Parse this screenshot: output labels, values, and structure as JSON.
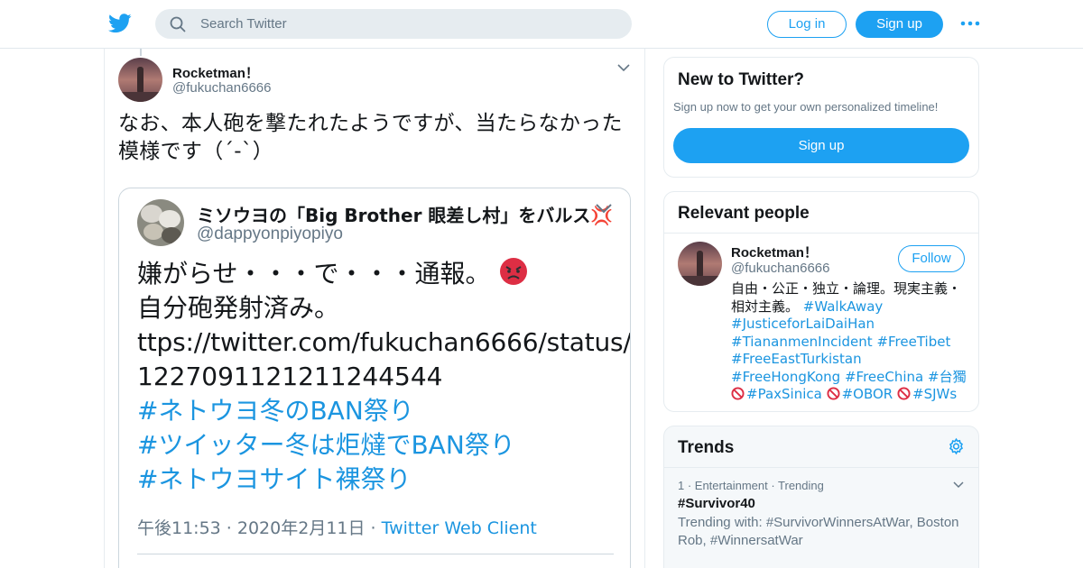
{
  "header": {
    "search_placeholder": "Search Twitter",
    "login_label": "Log in",
    "signup_label": "Sign up",
    "accent": "#1da1f2"
  },
  "tweet": {
    "name": "Rocketman！",
    "handle": "@fukuchan6666",
    "text": "なお、本人砲を撃たれたようですが、当たらなかった模様です（´-`）"
  },
  "quoted": {
    "name": "ミソウヨの「Big Brother 眼差し村」をバルス💢",
    "handle": "@dappyonpiyopiyo",
    "line1": "嫌がらせ・・・で・・・通報。",
    "line2": "自分砲発射済み。",
    "line3": "ttps://twitter.com/fukuchan6666/status/",
    "line4": "1227091121211244544",
    "hashtags": [
      "#ネトウヨ冬のBAN祭り",
      "#ツイッター冬は炬燵でBAN祭り",
      "#ネトウヨサイト裸祭り"
    ],
    "timestamp": "午後11:53 · 2020年2月11日 · ",
    "client": "Twitter Web Client"
  },
  "new_to_twitter": {
    "title": "New to Twitter?",
    "subtitle": "Sign up now to get your own personalized timeline!",
    "button": "Sign up"
  },
  "relevant_people": {
    "title": "Relevant people",
    "name": "Rocketman！",
    "handle": "@fukuchan6666",
    "follow": "Follow",
    "bio_text": "自由・公正・独立・論理。現実主義・相対主義。",
    "bio_tags": [
      "#WalkAway",
      "#JusticeforLaiDaiHan",
      "#TiananmenIncident",
      "#FreeTibet",
      "#FreeEastTurkistan",
      "#FreeHongKong",
      "#FreeChina",
      "#台獨",
      "#PaxSinica",
      "#OBOR",
      "#SJWs"
    ]
  },
  "trends": {
    "title": "Trends",
    "items": [
      {
        "meta": "1 · Entertainment · Trending",
        "name": "#Survivor40",
        "with": "Trending with: #SurvivorWinnersAtWar, Boston Rob, #WinnersatWar"
      }
    ]
  }
}
